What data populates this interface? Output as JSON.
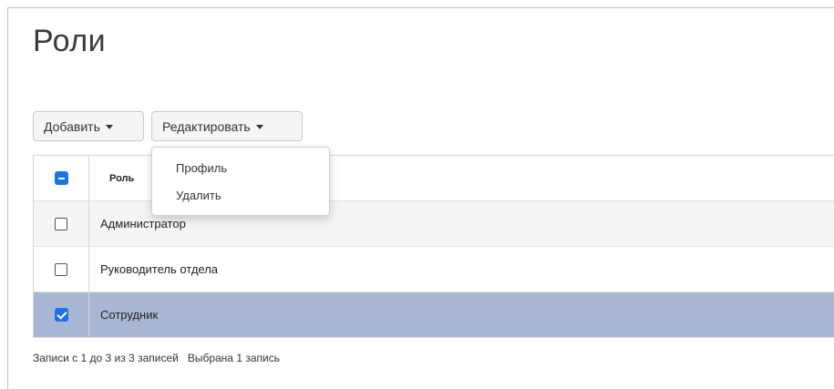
{
  "page": {
    "title": "Роли"
  },
  "toolbar": {
    "add_label": "Добавить",
    "edit_label": "Редактировать"
  },
  "edit_menu": {
    "items": [
      {
        "label": "Профиль"
      },
      {
        "label": "Удалить"
      }
    ]
  },
  "table": {
    "header": {
      "column": "Роль",
      "select_all_state": "indeterminate"
    },
    "rows": [
      {
        "label": "Администратор",
        "checked": false
      },
      {
        "label": "Руководитель отдела",
        "checked": false
      },
      {
        "label": "Сотрудник",
        "checked": true
      }
    ]
  },
  "footer": {
    "records_info": "Записи с 1 до 3 из 3 записей",
    "selection_info": "Выбрана 1 запись"
  },
  "colors": {
    "selected_row": "#a8b8d4",
    "checkbox_accent": "#1a73e8"
  }
}
